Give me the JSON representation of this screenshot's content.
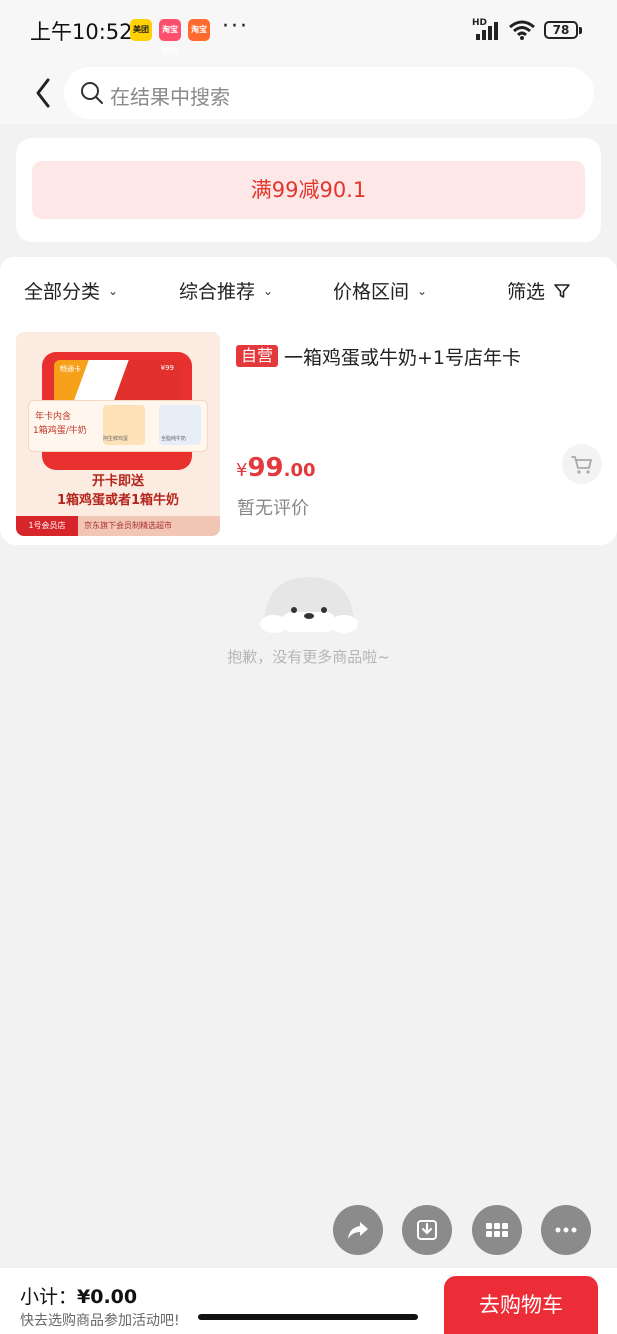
{
  "status_bar": {
    "time": "上午10:52",
    "apps": [
      {
        "name": "美团",
        "color": "#ffd100",
        "text_color": "#222"
      },
      {
        "name": "淘宝特价",
        "color": "#ff4f6e",
        "text_color": "#fff"
      },
      {
        "name": "淘宝",
        "color": "#ff6a2e",
        "text_color": "#fff"
      }
    ],
    "more": "···",
    "network": "HD",
    "battery": "78"
  },
  "search": {
    "placeholder": "在结果中搜索"
  },
  "promo": {
    "label": "满99减90.1"
  },
  "filters": [
    {
      "label": "全部分类",
      "icon": "chevron-down-icon"
    },
    {
      "label": "综合推荐",
      "icon": "chevron-down-icon"
    },
    {
      "label": "价格区间",
      "icon": "chevron-down-icon"
    },
    {
      "label": "筛选",
      "icon": "filter-icon"
    }
  ],
  "product": {
    "badge": "自营",
    "title": "一箱鸡蛋或牛奶+1号店年卡",
    "price_symbol": "¥",
    "price_integer": "99",
    "price_decimal": ".00",
    "review": "暂无评价",
    "image": {
      "card_label": "畅通卡",
      "card_price": "¥99",
      "inner_text_1": "年卡内含",
      "inner_text_2": "1箱鸡蛋/牛奶",
      "egg_label": "阿生鲜鸡蛋",
      "milk_label": "全脂纯牛奶",
      "promo_1": "开卡即送",
      "promo_2": "1箱鸡蛋或者1箱牛奶",
      "store": "1号会员店",
      "footer": "京东旗下会员制精选超市"
    }
  },
  "empty_state": {
    "text": "抱歉，没有更多商品啦~"
  },
  "fabs": [
    "share-icon",
    "download-icon",
    "grid-icon",
    "more-icon"
  ],
  "bottom": {
    "subtotal_label": "小计：",
    "subtotal_value": "¥0.00",
    "hint": "快去选购商品参加活动吧!",
    "checkout": "去购物车"
  },
  "colors": {
    "accent": "#e4393c",
    "checkout": "#ec2c36",
    "promo_bg": "#fde7e7"
  }
}
